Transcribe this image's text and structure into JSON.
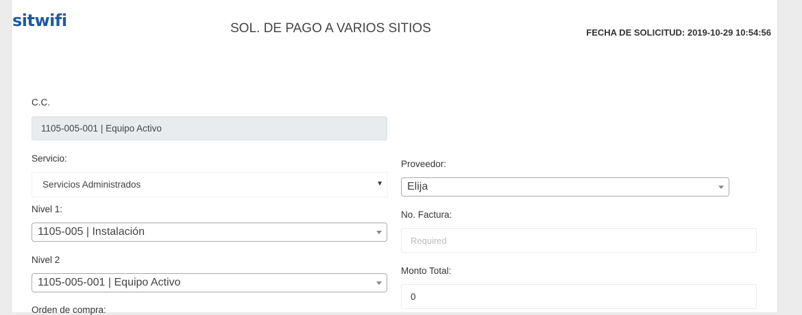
{
  "header": {
    "logo": "sitwifi",
    "title": "SOL. DE PAGO A VARIOS SITIOS",
    "date_line": "FECHA DE SOLICITUD: 2019-10-29 10:54:56"
  },
  "form": {
    "cc": {
      "label": "C.C.",
      "value": "1105-005-001 | Equipo Activo"
    },
    "servicio": {
      "label": "Servicio:",
      "value": "Servicios Administrados"
    },
    "proveedor": {
      "label": "Proveedor:",
      "value": "Elija"
    },
    "nivel1": {
      "label": "Nivel 1:",
      "value": "1105-005 | Instalación"
    },
    "factura": {
      "label": "No. Factura:",
      "placeholder": "Required"
    },
    "nivel2": {
      "label": "Nivel 2",
      "value": "1105-005-001 | Equipo Activo"
    },
    "monto": {
      "label": "Monto Total:",
      "value": "0"
    },
    "orden": {
      "label": "Orden de compra:"
    }
  }
}
